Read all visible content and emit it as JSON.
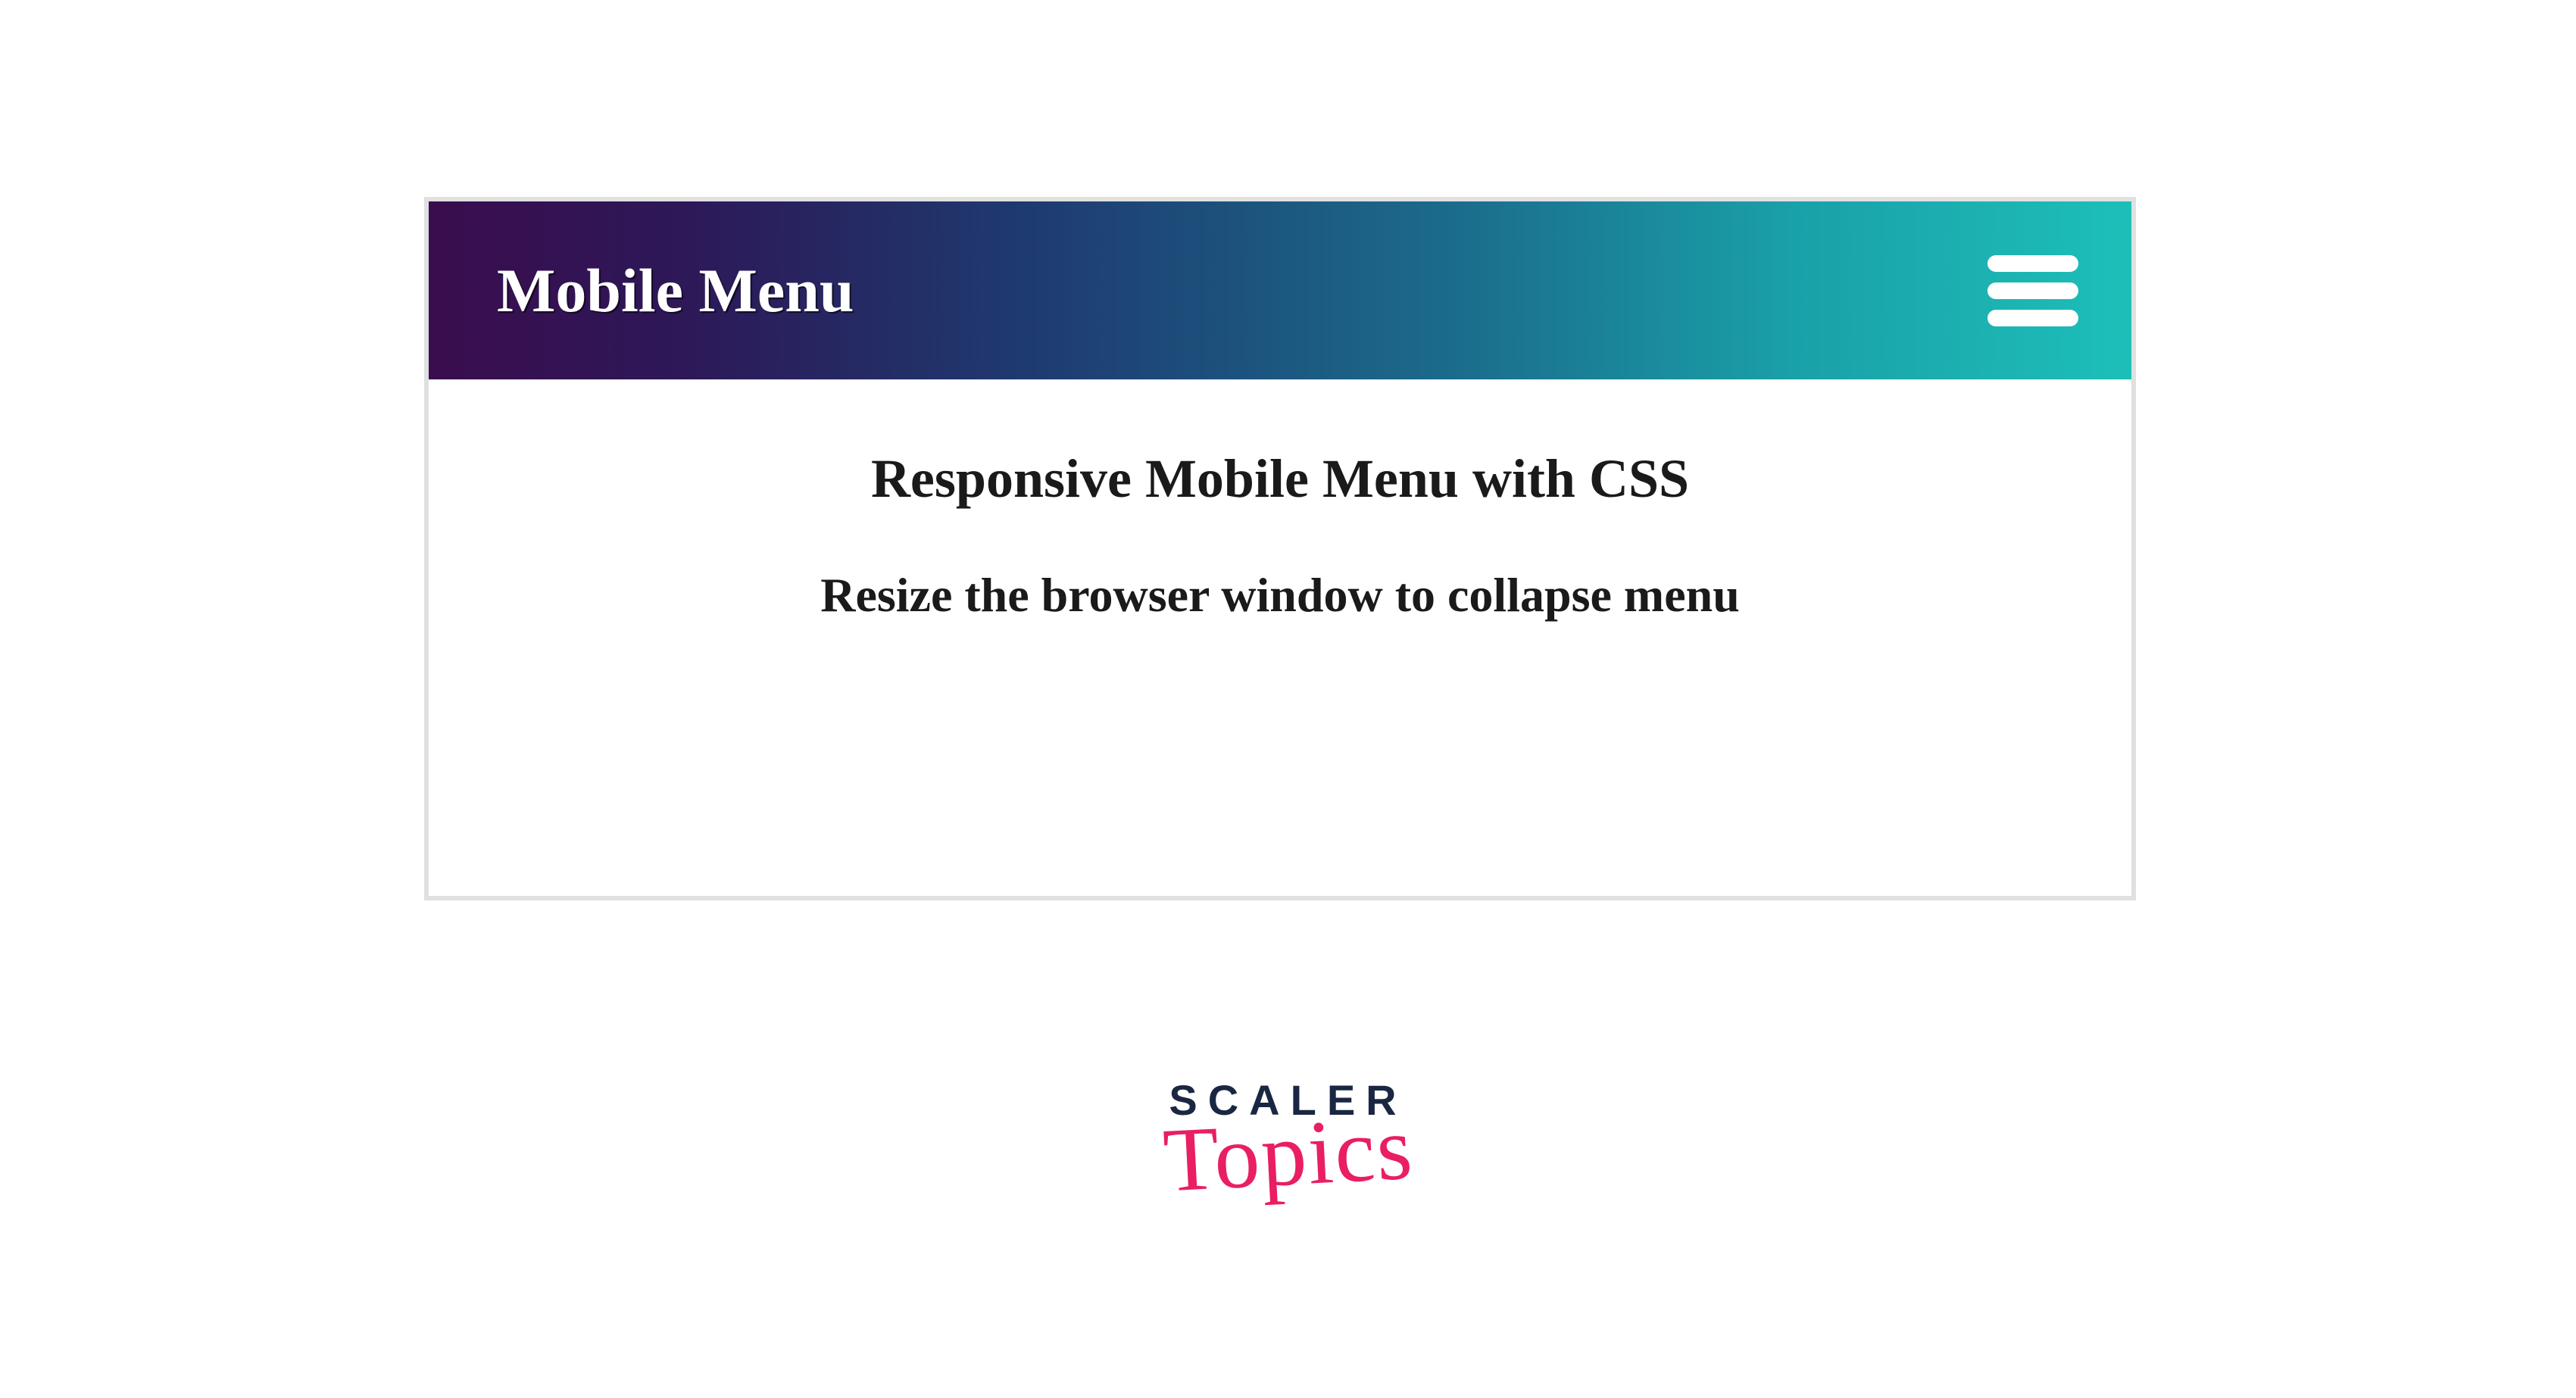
{
  "navbar": {
    "brand": "Mobile Menu"
  },
  "content": {
    "heading1": "Responsive Mobile Menu with CSS",
    "heading2": "Resize the browser window to collapse menu"
  },
  "logo": {
    "line1": "SCALER",
    "line2": "Topics"
  }
}
